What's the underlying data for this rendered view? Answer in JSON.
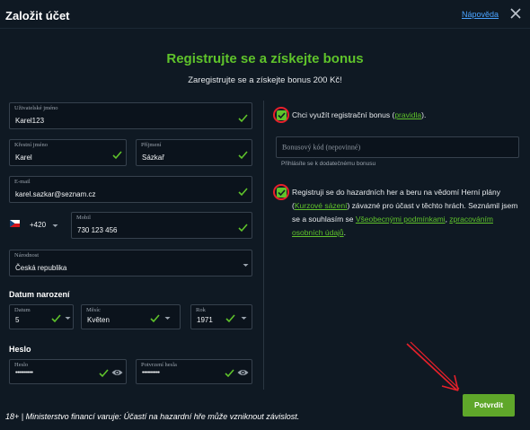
{
  "header": {
    "title": "Založit účet",
    "help_link": "Nápověda"
  },
  "heading": {
    "title": "Registrujte se a získejte bonus",
    "subtitle": "Zaregistrujte se a získejte bonus 200 Kč!"
  },
  "form": {
    "username": {
      "label": "Uživatelské jméno",
      "value": "Karel123"
    },
    "first_name": {
      "label": "Křestní jméno",
      "value": "Karel"
    },
    "last_name": {
      "label": "Příjmení",
      "value": "Sázkař"
    },
    "email": {
      "label": "E-mail",
      "value": "karel.sazkar@seznam.cz"
    },
    "phone_prefix": "+420",
    "phone": {
      "label": "Mobil",
      "value": "730 123 456"
    },
    "nationality": {
      "label": "Národnost",
      "value": "Česká republika"
    },
    "birth_section": "Datum narození",
    "birth_day": {
      "label": "Datum",
      "value": "5"
    },
    "birth_month": {
      "label": "Měsíc",
      "value": "Květen"
    },
    "birth_year": {
      "label": "Rok",
      "value": "1971"
    },
    "password_section": "Heslo",
    "password": {
      "label": "Heslo",
      "value": "••••••••••"
    },
    "password_confirm": {
      "label": "Potvrzení hesla",
      "value": "••••••••••"
    }
  },
  "bonus": {
    "checkbox_text_before": "Chci využít registrační bonus (",
    "checkbox_link": "pravidla",
    "checkbox_text_after": ").",
    "checked": true,
    "code_placeholder": "Bonusový kód (nepovinné)",
    "hint": "Přihlásíte se k dodatečnému bonusu"
  },
  "terms": {
    "checked": true,
    "text1": "Registruji se do hazardních her a beru na vědomí Herní plány (",
    "link1": "Kurzové sázení",
    "text2": ") závazné pro účast v těchto hrách. Seznámil jsem se a souhlasím se ",
    "link2": "Všeobecnými podmínkami",
    "text3": ", ",
    "link3": "zpracováním osobních údajů",
    "text4": "."
  },
  "submit_label": "Potvrdit",
  "footer_text": "18+ | Ministerstvo financí varuje: Účastí na hazardní hře může vzniknout závislost.",
  "colors": {
    "accent": "#5fc32b",
    "background": "#0f1923",
    "annotation": "#e8202a",
    "link": "#4aa3ff"
  }
}
